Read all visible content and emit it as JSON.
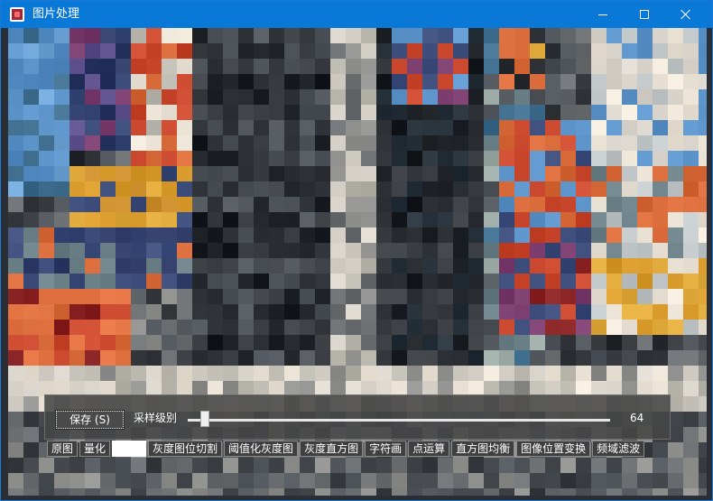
{
  "window": {
    "title": "图片处理",
    "app_icon": "image-processing-app-icon",
    "controls": {
      "minimize_icon": "minimize-icon",
      "maximize_icon": "maximize-icon",
      "close_icon": "close-icon"
    }
  },
  "controls": {
    "save_label": "保存 (S)",
    "level_label": "采样级别",
    "slider_value": "64",
    "slider_fraction": 0.04
  },
  "tabs": [
    "原图",
    "量化",
    "",
    "灰度图位切割",
    "阈值化灰度图",
    "灰度直方图",
    "字符画",
    "点运算",
    "直方图均衡",
    "图像位置变换",
    "频域滤波"
  ],
  "selected_tab_index": 2,
  "colors": {
    "titlebar": "#0a78d7",
    "panel": "#464646",
    "image_palette": [
      "#2a2e33",
      "#1c1f23",
      "#3b3f44",
      "#4f555b",
      "#6c6f72",
      "#8f8f8d",
      "#b9b6ae",
      "#d8d4cc",
      "#5c93c9",
      "#3b4b7a",
      "#7a3d6e",
      "#d86a3a",
      "#c9472c",
      "#8b2424",
      "#e0a93b",
      "#6b7f86",
      "#9aa9a3",
      "#c0c6c8",
      "#3f6e8f",
      "#eae3d6"
    ]
  }
}
